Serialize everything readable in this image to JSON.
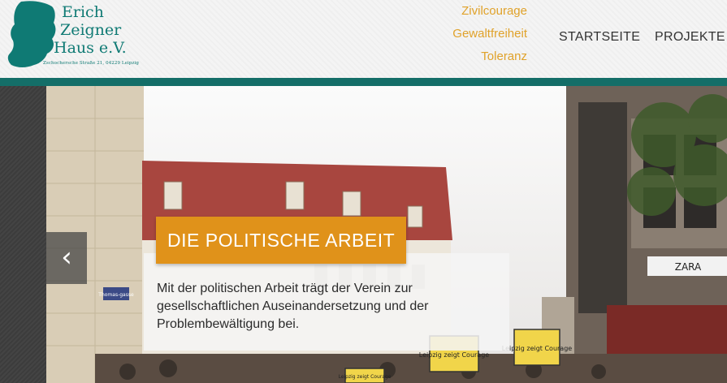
{
  "header": {
    "logo": {
      "line1": "Erich",
      "line2": "Zeigner",
      "line3": "Haus e.V.",
      "address": "Zschochersche Straße 21, 04229 Leipzig",
      "color": "#0f7a74"
    },
    "taglines": [
      "Zivilcourage",
      "Gewaltfreiheit",
      "Toleranz"
    ],
    "tagline_color": "#e0a22a",
    "nav": [
      {
        "label": "STARTSEITE"
      },
      {
        "label": "PROJEKTE"
      }
    ],
    "accent_bar_color": "#146e68"
  },
  "slider": {
    "prev_icon": "chevron-left-icon",
    "prev_glyph": "‹",
    "slide": {
      "title": "DIE POLITISCHE ARBEIT",
      "text": "Mit der politischen Arbeit trägt der Verein zur gesellschaftlichen Auseinandersetzung und der Problembewältigung bei.",
      "title_bg": "#e0921a"
    },
    "photo_signs": [
      {
        "text": "Leipzig zeigt Courage"
      },
      {
        "text": "Leipzig zeigt Courage"
      },
      {
        "text": "Leipzig zeigt Courage"
      }
    ],
    "street_sign": "Thomas-gasse",
    "store_sign": "ZARA"
  }
}
